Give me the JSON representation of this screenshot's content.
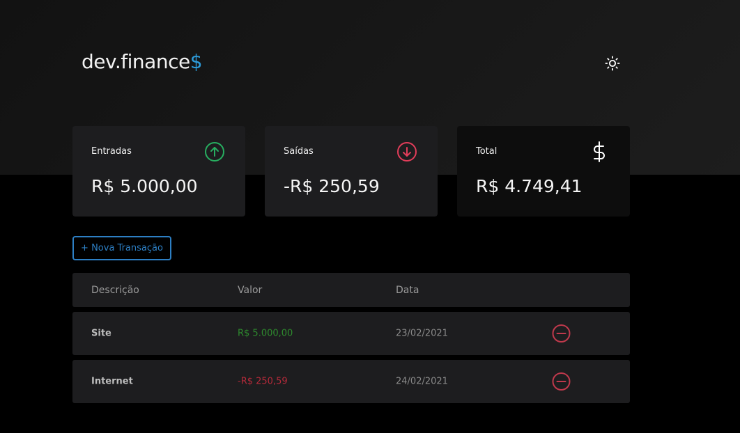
{
  "header": {
    "logo_text": "dev.finance",
    "logo_accent": "$",
    "theme_icon": "sun-icon"
  },
  "cards": [
    {
      "label": "Entradas",
      "value": "R$ 5.000,00",
      "icon": "arrow-up-circle-icon",
      "icon_color": "#27ae60"
    },
    {
      "label": "Saídas",
      "value": "-R$ 250,59",
      "icon": "arrow-down-circle-icon",
      "icon_color": "#e23d5a"
    },
    {
      "label": "Total",
      "value": "R$ 4.749,41",
      "icon": "dollar-sign-icon",
      "icon_color": "#ffffff"
    }
  ],
  "new_transaction_label": "+ Nova Transação",
  "table": {
    "headers": [
      "Descrição",
      "Valor",
      "Data"
    ],
    "rows": [
      {
        "description": "Site",
        "amount": "R$ 5.000,00",
        "date": "23/02/2021",
        "type": "income"
      },
      {
        "description": "Internet",
        "amount": "-R$ 250,59",
        "date": "24/02/2021",
        "type": "expense"
      }
    ]
  },
  "colors": {
    "accent": "#2d9cdb",
    "income": "#2e8b2e",
    "expense": "#b52a3a",
    "remove": "#c0394c"
  }
}
